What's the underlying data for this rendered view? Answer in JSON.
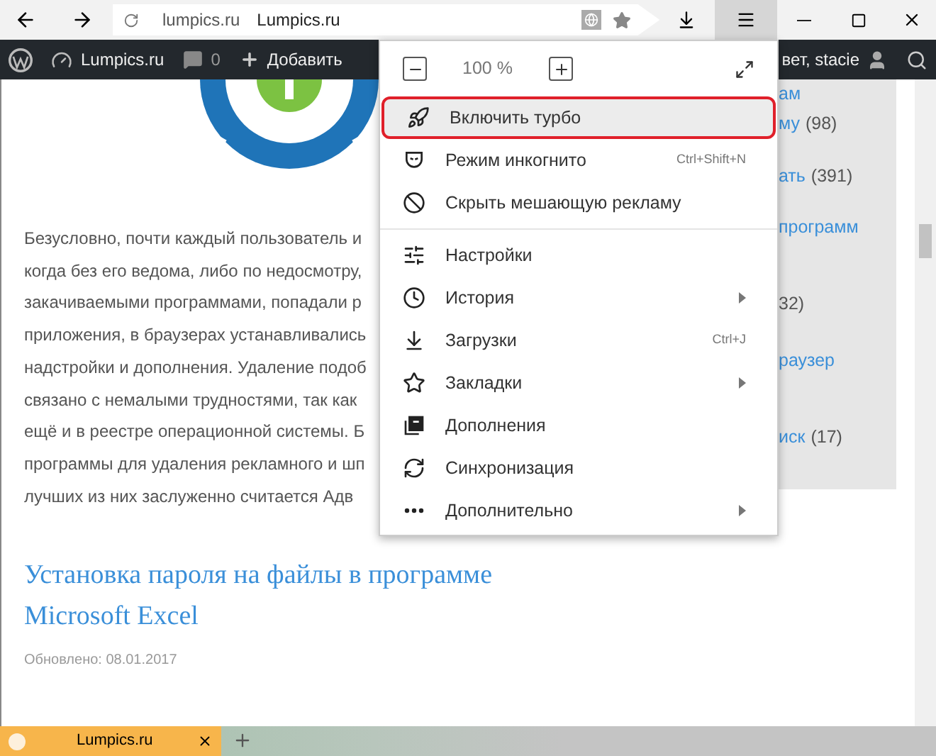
{
  "window": {
    "address_host": "lumpics.ru",
    "page_title": "Lumpics.ru"
  },
  "admin_bar": {
    "site": "Lumpics.ru",
    "comments": "0",
    "add": "Добавить",
    "greeting": "вет, stacie"
  },
  "article": {
    "lines": [
      "Безусловно, почти каждый пользователь и",
      "когда без его ведома, либо по недосмотру,",
      "закачиваемыми программами, попадали р",
      "приложения, в браузерах устанавливались",
      "надстройки и дополнения. Удаление подоб",
      "связано с немалыми трудностями, так как",
      "ещё и в реестре операционной системы. Б",
      "программы для удаления рекламного и шп",
      "лучших из них заслуженно считается Адв"
    ],
    "heading": "Установка пароля на файлы в программе Microsoft Excel",
    "updated": "Обновлено: 08.01.2017"
  },
  "sidebar": {
    "entries": [
      {
        "link": "ам"
      },
      {
        "link": "му",
        "count": "(98)"
      },
      {
        "link": "ать",
        "count": "(391)"
      },
      {
        "link": "программ"
      },
      {
        "count": "32)"
      },
      {
        "link": "раузер"
      },
      {
        "link": "иск",
        "count": "(17)"
      }
    ]
  },
  "menu": {
    "zoom": "100 %",
    "groups": [
      [
        {
          "label": "Включить турбо",
          "selected": true,
          "submenu": false
        },
        {
          "label": "Режим инкогнито",
          "shortcut": "Ctrl+Shift+N",
          "selected": false,
          "submenu": false
        },
        {
          "label": "Скрыть мешающую рекламу",
          "selected": false,
          "submenu": false
        }
      ],
      [
        {
          "label": "Настройки",
          "selected": false,
          "submenu": false
        },
        {
          "label": "История",
          "selected": false,
          "submenu": true
        },
        {
          "label": "Загрузки",
          "shortcut": "Ctrl+J",
          "selected": false,
          "submenu": false
        },
        {
          "label": "Закладки",
          "selected": false,
          "submenu": true
        },
        {
          "label": "Дополнения",
          "selected": false,
          "submenu": false
        },
        {
          "label": "Синхронизация",
          "selected": false,
          "submenu": false
        },
        {
          "label": "Дополнительно",
          "selected": false,
          "submenu": true
        }
      ]
    ]
  },
  "tabs": [
    {
      "title": "Lumpics.ru",
      "selected": true
    }
  ]
}
